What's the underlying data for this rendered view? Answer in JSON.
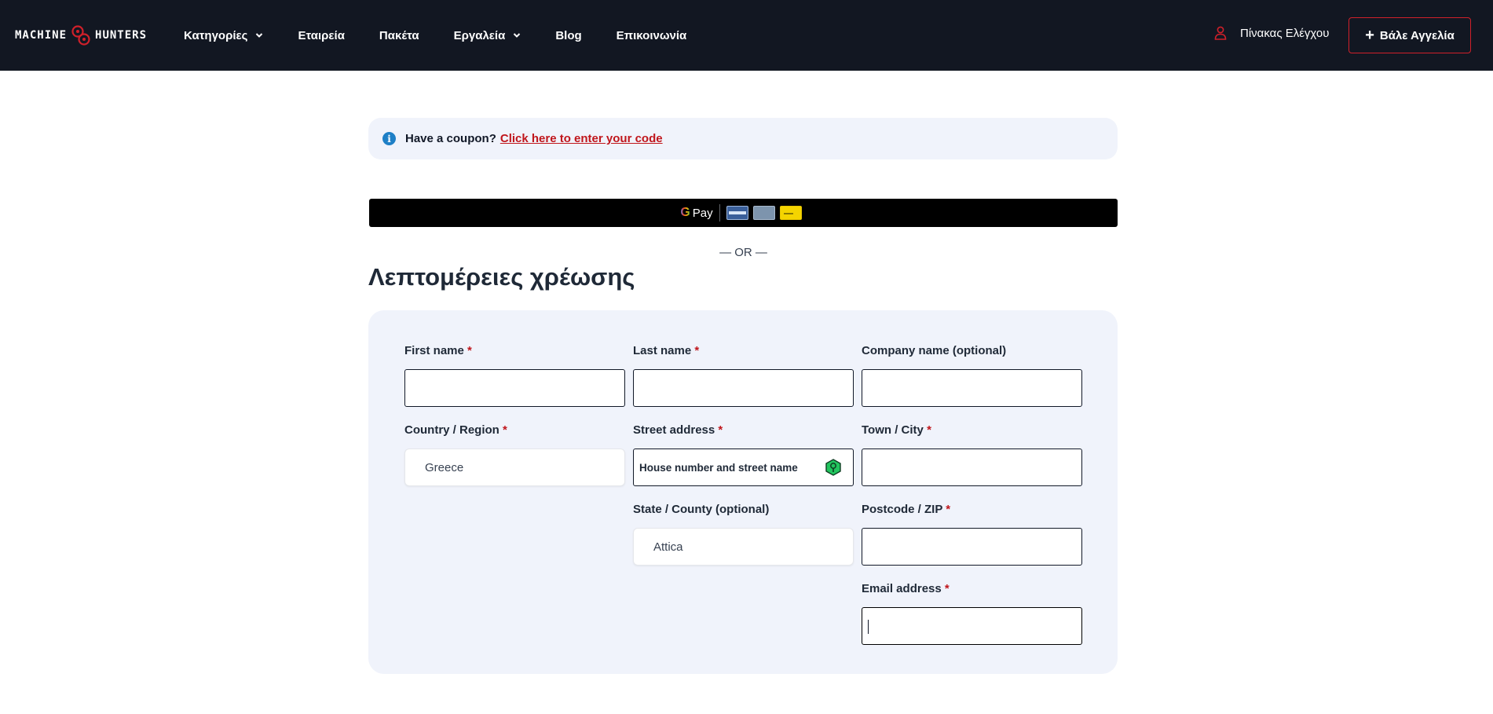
{
  "header": {
    "logo_left": "MACHINE",
    "logo_right": "HUNTERS",
    "nav": [
      {
        "label": "Κατηγορίες",
        "dropdown": true
      },
      {
        "label": "Εταιρεία",
        "dropdown": false
      },
      {
        "label": "Πακέτα",
        "dropdown": false
      },
      {
        "label": "Εργαλεία",
        "dropdown": true
      },
      {
        "label": "Blog",
        "dropdown": false
      },
      {
        "label": "Επικοινωνία",
        "dropdown": false
      }
    ],
    "dashboard_label": "Πίνακας Ελέγχου",
    "post_ad_label": "Βάλε Αγγελία",
    "accent_color": "#d0202a"
  },
  "coupon": {
    "question": "Have a coupon?",
    "link": "Click here to enter your code"
  },
  "gpay": {
    "g": "G",
    "label": "Pay"
  },
  "or_text": "— OR —",
  "billing": {
    "title": "Λεπτομέρειες χρέωσης",
    "fields": {
      "first_name": {
        "label": "First name",
        "required": "*",
        "value": ""
      },
      "last_name": {
        "label": "Last name",
        "required": "*",
        "value": ""
      },
      "company": {
        "label": "Company name (optional)",
        "value": ""
      },
      "country": {
        "label": "Country / Region",
        "required": "*",
        "value": "Greece"
      },
      "street": {
        "label": "Street address",
        "required": "*",
        "placeholder": "House number and street name"
      },
      "city": {
        "label": "Town / City",
        "required": "*",
        "value": ""
      },
      "state": {
        "label": "State / County (optional)",
        "value": "Attica"
      },
      "postcode": {
        "label": "Postcode / ZIP",
        "required": "*",
        "value": ""
      },
      "email": {
        "label": "Email address",
        "required": "*",
        "value": ""
      }
    }
  }
}
